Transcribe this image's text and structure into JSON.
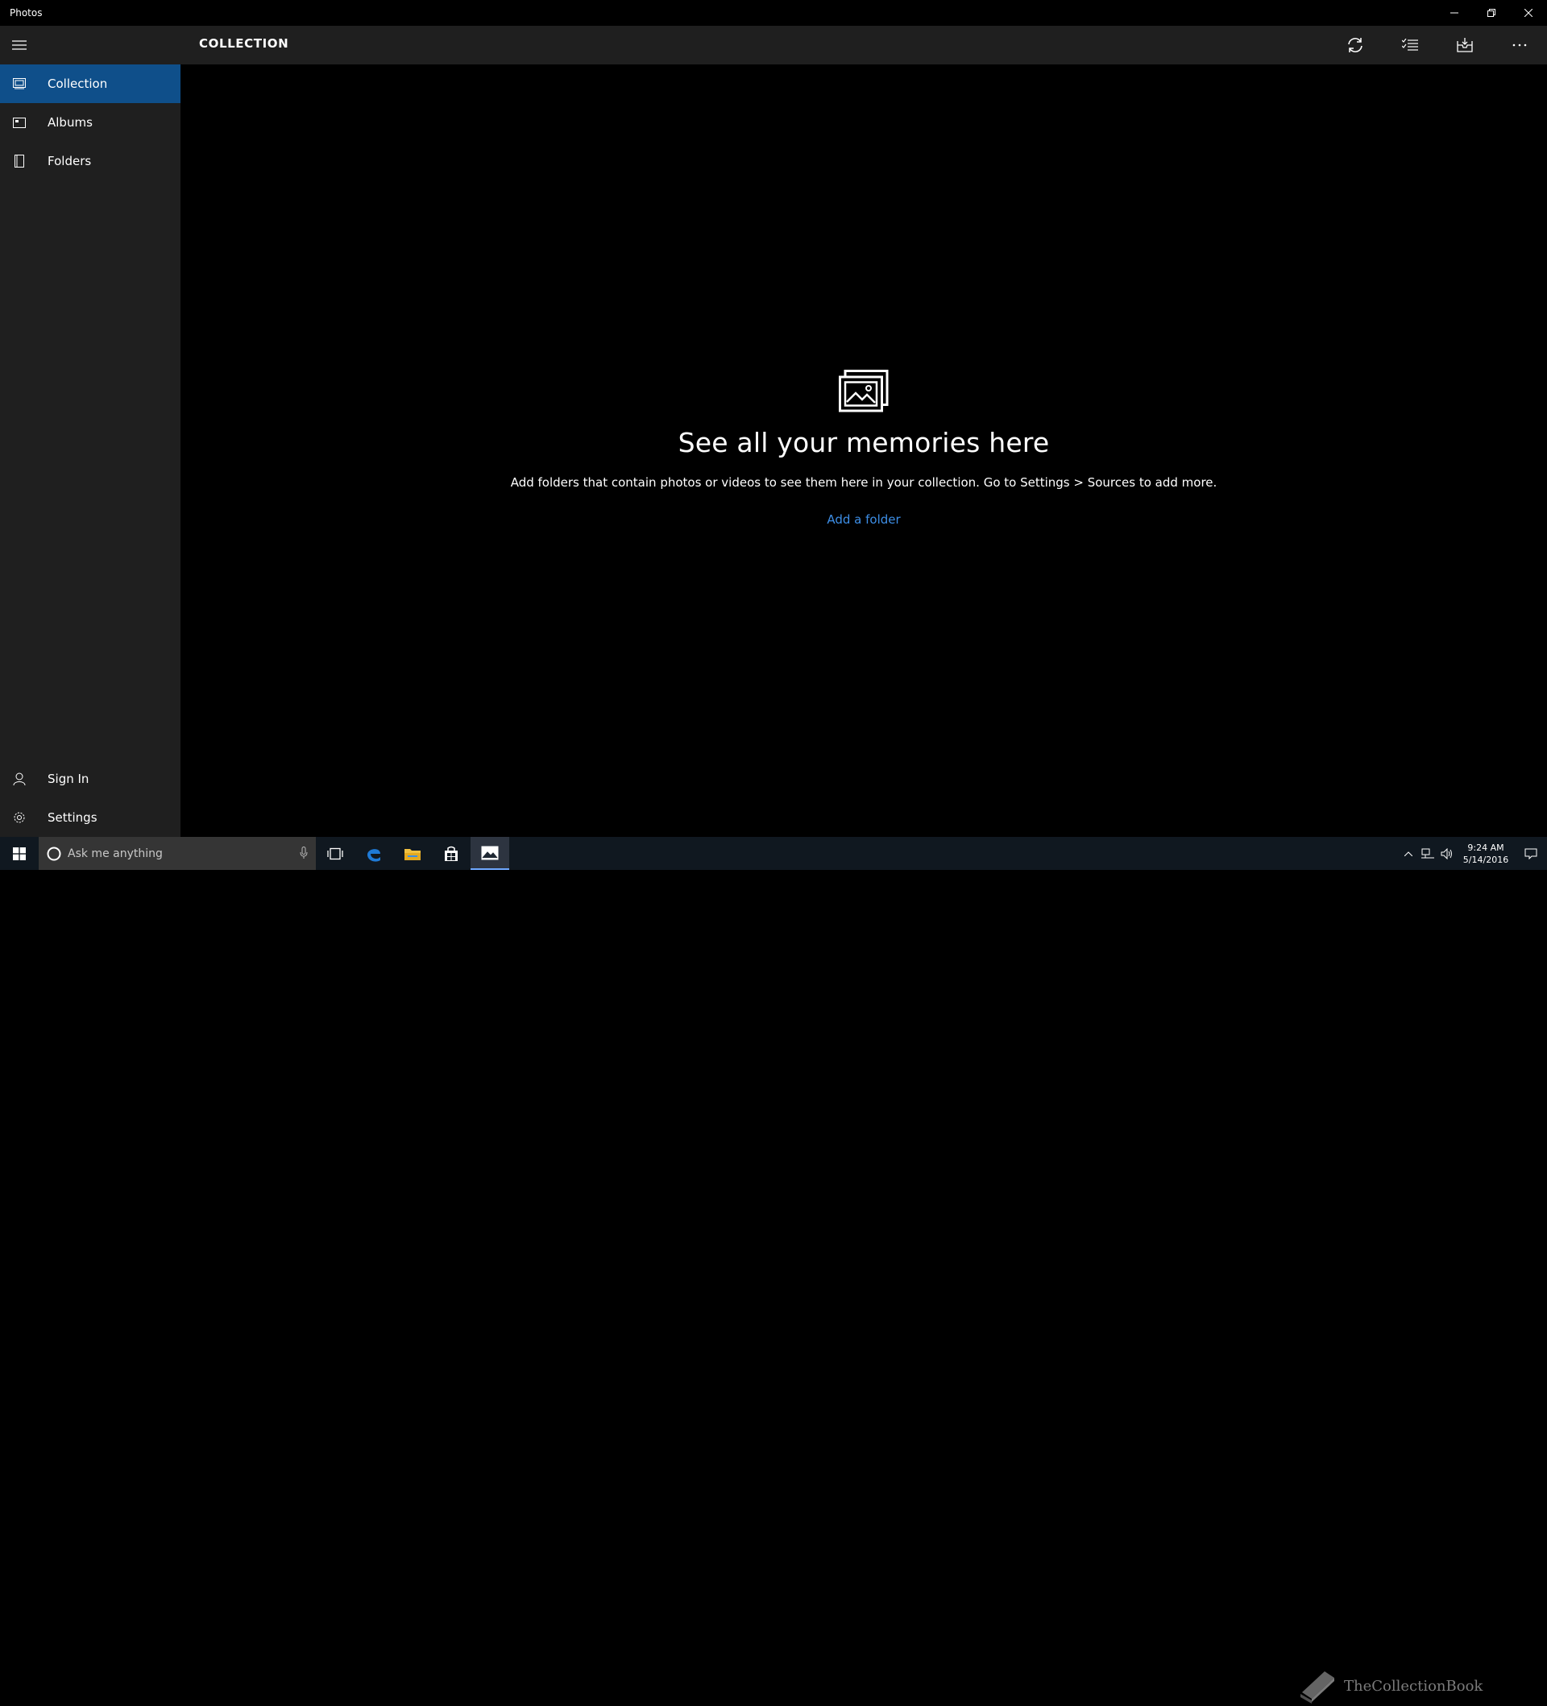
{
  "window": {
    "app_title": "Photos",
    "controls": [
      "minimize-icon",
      "restore-icon",
      "close-icon"
    ]
  },
  "sidebar": {
    "menu_icon": "hamburger-icon",
    "items": [
      {
        "label": "Collection",
        "icon": "collection-icon",
        "active": true
      },
      {
        "label": "Albums",
        "icon": "albums-icon",
        "active": false
      },
      {
        "label": "Folders",
        "icon": "folders-icon",
        "active": false
      }
    ],
    "footer_items": [
      {
        "label": "Sign In",
        "icon": "person-icon"
      },
      {
        "label": "Settings",
        "icon": "gear-icon"
      }
    ],
    "active_color": "#0f4f8a"
  },
  "header": {
    "title": "COLLECTION",
    "actions": [
      "refresh-icon",
      "select-icon",
      "import-icon",
      "more-icon"
    ]
  },
  "empty_state": {
    "icon": "photos-stack-icon",
    "heading": "See all your memories here",
    "body": "Add folders that contain photos or videos to see them here in your collection. Go to Settings > Sources to add more.",
    "link": "Add a folder",
    "link_color": "#3d8ee6"
  },
  "taskbar": {
    "search_placeholder": "Ask me anything",
    "pinned": [
      "task-view-icon",
      "edge-icon",
      "file-explorer-icon",
      "store-icon",
      "photos-icon"
    ],
    "clock_time": "9:24 AM",
    "clock_date": "5/14/2016",
    "watermark": "TheCollectionBook"
  }
}
